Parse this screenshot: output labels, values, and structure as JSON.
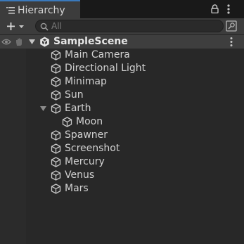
{
  "window": {
    "tab_title": "Hierarchy"
  },
  "toolbar": {
    "add_label": "+",
    "search_placeholder": "All",
    "search_value": ""
  },
  "scene": {
    "name": "SampleScene",
    "expanded": true
  },
  "items": [
    {
      "label": "Main Camera",
      "depth": 1,
      "has_children": false
    },
    {
      "label": "Directional Light",
      "depth": 1,
      "has_children": false
    },
    {
      "label": "Minimap",
      "depth": 1,
      "has_children": false
    },
    {
      "label": "Sun",
      "depth": 1,
      "has_children": false
    },
    {
      "label": "Earth",
      "depth": 1,
      "has_children": true,
      "expanded": true
    },
    {
      "label": "Moon",
      "depth": 2,
      "has_children": false
    },
    {
      "label": "Spawner",
      "depth": 1,
      "has_children": false
    },
    {
      "label": "Screenshot",
      "depth": 1,
      "has_children": false
    },
    {
      "label": "Mercury",
      "depth": 1,
      "has_children": false
    },
    {
      "label": "Venus",
      "depth": 1,
      "has_children": false
    },
    {
      "label": "Mars",
      "depth": 1,
      "has_children": false
    }
  ],
  "colors": {
    "accent": "#3a79bb",
    "panel_bg": "#282828",
    "toolbar_bg": "#3c3c3c",
    "text": "#d2d2d2",
    "scene_row_bg": "#3e3e3e"
  }
}
